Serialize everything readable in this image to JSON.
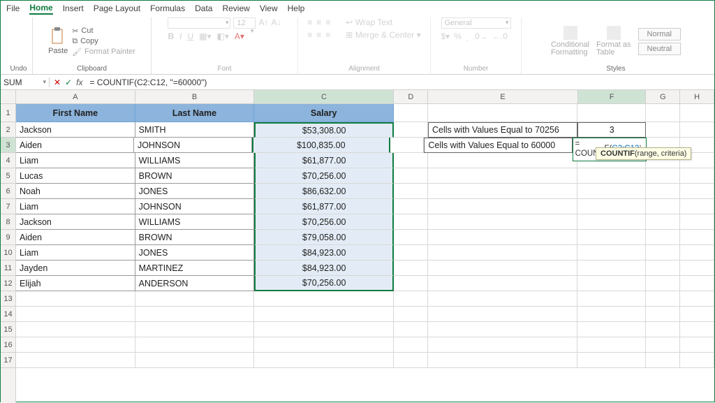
{
  "menu": {
    "items": [
      "File",
      "Home",
      "Insert",
      "Page Layout",
      "Formulas",
      "Data",
      "Review",
      "View",
      "Help"
    ],
    "active": 1
  },
  "ribbon": {
    "undo": {
      "label": "Undo"
    },
    "clipboard": {
      "paste": "Paste",
      "cut": "Cut",
      "copy": "Copy",
      "painter": "Format Painter",
      "label": "Clipboard"
    },
    "font": {
      "size": "12",
      "label": "Font"
    },
    "alignment": {
      "wrap": "Wrap Text",
      "merge": "Merge & Center",
      "label": "Alignment"
    },
    "number": {
      "format": "General",
      "label": "Number"
    },
    "styles": {
      "cond": "Conditional\nFormatting",
      "fmtTable": "Format as\nTable",
      "normal": "Normal",
      "neutral": "Neutral",
      "label": "Styles"
    }
  },
  "fbar": {
    "name": "SUM",
    "formula": "= COUNTIF(C2:C12, \"=60000\")"
  },
  "columns": [
    "A",
    "B",
    "C",
    "D",
    "E",
    "F",
    "G",
    "H"
  ],
  "rows": [
    1,
    2,
    3,
    4,
    5,
    6,
    7,
    8,
    9,
    10,
    11,
    12,
    13,
    14,
    15,
    16,
    17
  ],
  "table": {
    "headers": {
      "a": "First Name",
      "b": "Last Name",
      "c": "Salary"
    },
    "data": [
      {
        "a": "Jackson",
        "b": "SMITH",
        "c": "$53,308.00"
      },
      {
        "a": "Aiden",
        "b": "JOHNSON",
        "c": "$100,835.00"
      },
      {
        "a": "Liam",
        "b": "WILLIAMS",
        "c": "$61,877.00"
      },
      {
        "a": "Lucas",
        "b": "BROWN",
        "c": "$70,256.00"
      },
      {
        "a": "Noah",
        "b": "JONES",
        "c": "$86,632.00"
      },
      {
        "a": "Liam",
        "b": "JOHNSON",
        "c": "$61,877.00"
      },
      {
        "a": "Jackson",
        "b": "WILLIAMS",
        "c": "$70,256.00"
      },
      {
        "a": "Aiden",
        "b": "BROWN",
        "c": "$79,058.00"
      },
      {
        "a": "Liam",
        "b": "JONES",
        "c": "$84,923.00"
      },
      {
        "a": "Jayden",
        "b": "MARTINEZ",
        "c": "$84,923.00"
      },
      {
        "a": "Elijah",
        "b": "ANDERSON",
        "c": "$70,256.00"
      }
    ]
  },
  "side": {
    "e2": "Cells with Values Equal to 70256",
    "f2": "3",
    "e3": "Cells with Values Equal to 60000",
    "f3_prefix": "= COUNT",
    "f3_cursor": "I",
    "f3_fn": "F(",
    "f3_ref": "C2:C12",
    "f3_rest": ", \"=60000\")"
  },
  "tooltip": {
    "fn": "COUNTIF",
    "args": "(range, criteria)"
  }
}
